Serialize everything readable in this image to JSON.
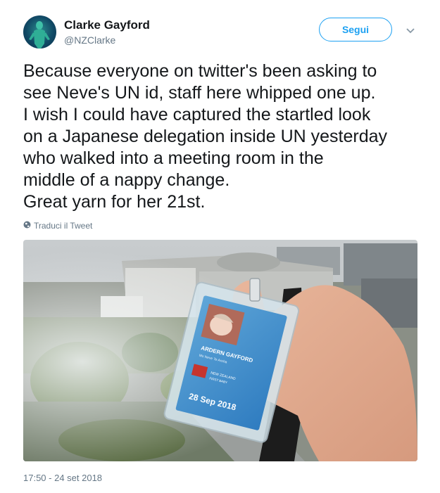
{
  "author": {
    "name": "Clarke Gayford",
    "handle": "@NZClarke",
    "avatar_icon": "avatar-photo"
  },
  "follow_label": "Segui",
  "more_icon": "chevron-down-icon",
  "tweet": {
    "lines": [
      "Because everyone on twitter's been asking to",
      "see Neve's UN id, staff here whipped one up.",
      "I wish I could have captured the startled look",
      "on a Japanese delegation inside UN yesterday",
      "who walked into a meeting room in the",
      "middle of a nappy change.",
      "Great yarn for her 21st."
    ]
  },
  "translate_label": "Traduci il Tweet",
  "translate_icon": "globe-icon",
  "photo": {
    "card": {
      "name": "ARDERN GAYFORD",
      "subname": "Ms Neve Te Aroha",
      "country": "NEW ZEALAND",
      "role": "FIRST BABY",
      "date": "28 Sep 2018"
    }
  },
  "timestamp": "17:50 - 24 set 2018",
  "colors": {
    "accent": "#1da1f2",
    "secondary_text": "#657786",
    "primary_text": "#14171a"
  }
}
